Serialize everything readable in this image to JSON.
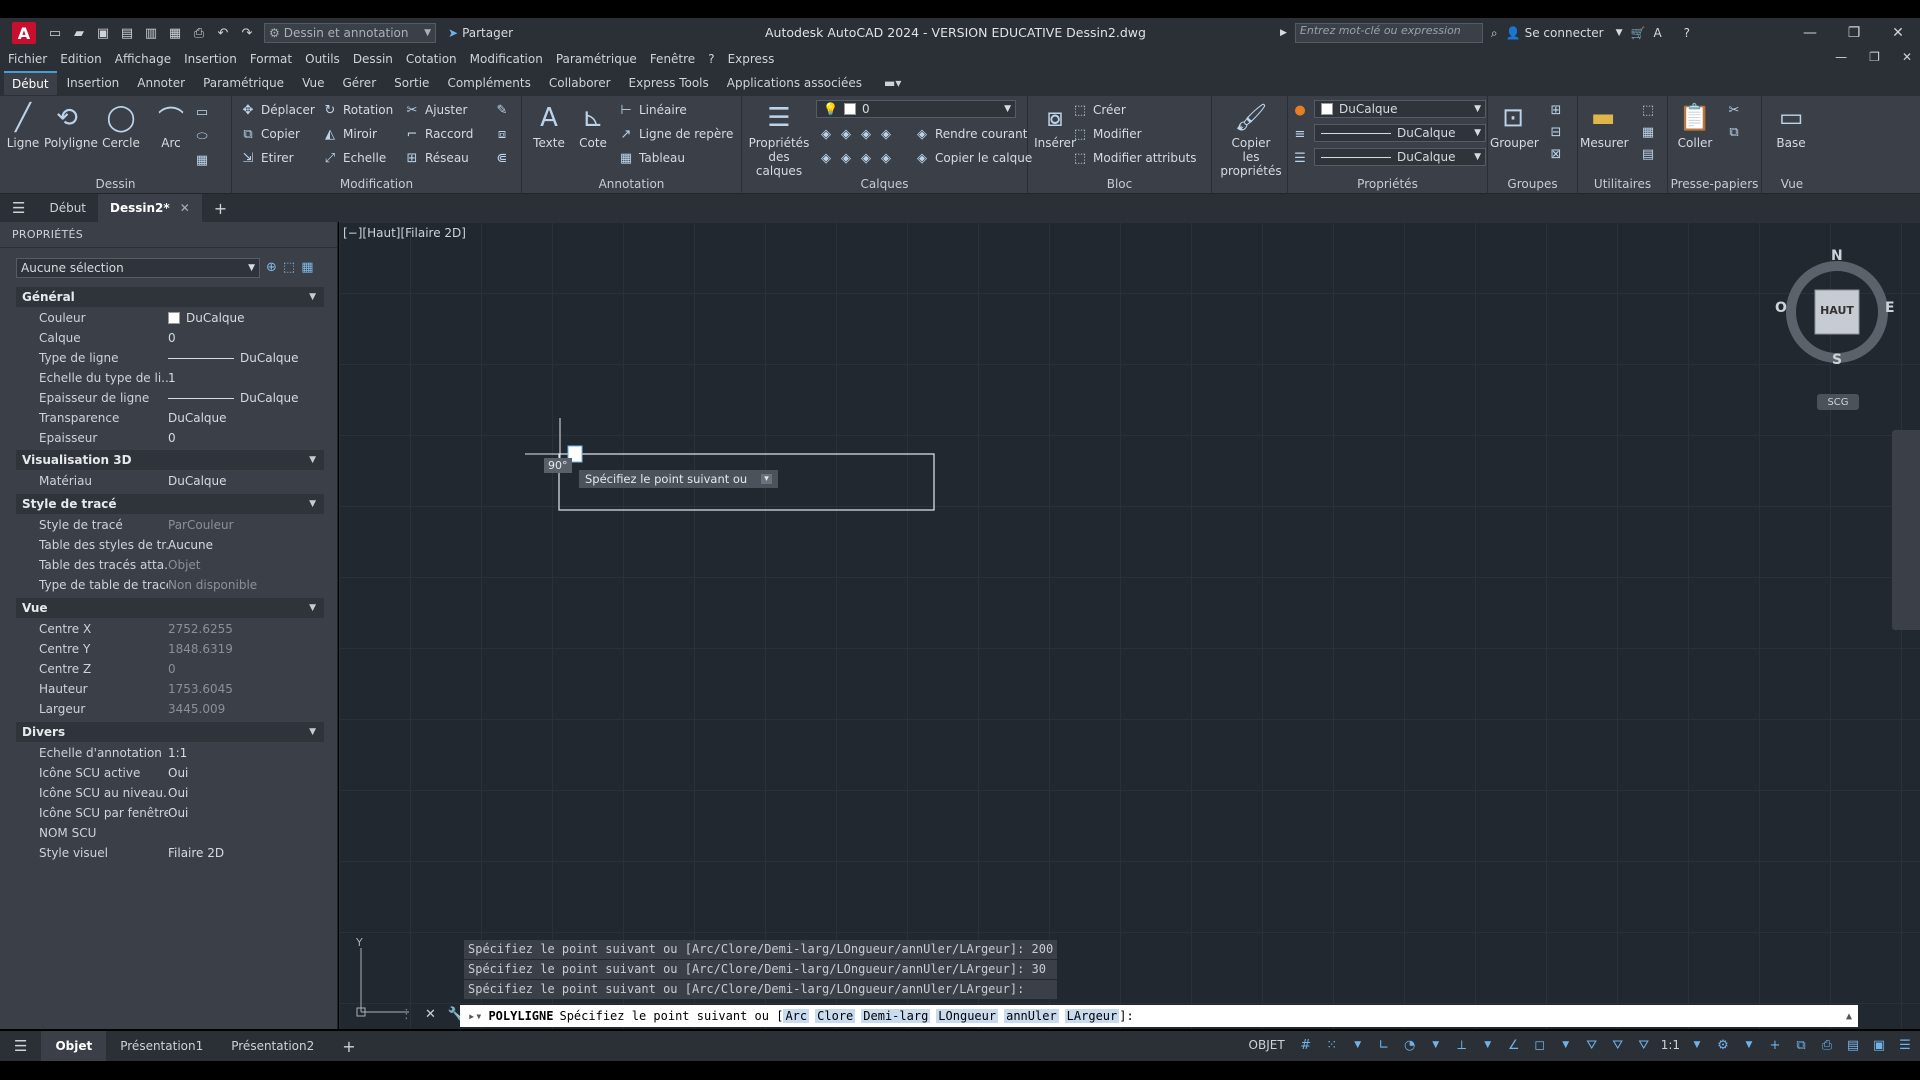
{
  "window": {
    "title": "Autodesk AutoCAD 2024 - VERSION EDUCATIVE    Dessin2.dwg",
    "workspace": "Dessin et annotation",
    "share_label": "Partager",
    "search_placeholder": "Entrez mot-clé ou expression",
    "login_label": "Se connecter"
  },
  "menu": [
    "Fichier",
    "Edition",
    "Affichage",
    "Insertion",
    "Format",
    "Outils",
    "Dessin",
    "Cotation",
    "Modification",
    "Paramétrique",
    "Fenêtre",
    "?",
    "Express"
  ],
  "ribbon_tabs": [
    "Début",
    "Insertion",
    "Annoter",
    "Paramétrique",
    "Vue",
    "Gérer",
    "Sortie",
    "Compléments",
    "Collaborer",
    "Express Tools",
    "Applications associées"
  ],
  "ribbon": {
    "dessin": {
      "title": "Dessin",
      "ligne": "Ligne",
      "polyligne": "Polyligne",
      "cercle": "Cercle",
      "arc": "Arc"
    },
    "modification": {
      "title": "Modification",
      "deplacer": "Déplacer",
      "rotation": "Rotation",
      "ajuster": "Ajuster",
      "copier": "Copier",
      "miroir": "Miroir",
      "raccord": "Raccord",
      "etirer": "Etirer",
      "echelle": "Echelle",
      "reseau": "Réseau"
    },
    "annotation": {
      "title": "Annotation",
      "texte": "Texte",
      "cote": "Cote",
      "lineaire": "Linéaire",
      "ligne_repere": "Ligne de repère",
      "tableau": "Tableau"
    },
    "calques": {
      "title": "Calques",
      "proprietes_1": "Propriétés",
      "proprietes_2": "des calques",
      "current_layer": "0",
      "rendre_courant": "Rendre courant",
      "copier_calque": "Copier le calque"
    },
    "bloc": {
      "title": "Bloc",
      "inserer": "Insérer",
      "creer": "Créer",
      "modifier": "Modifier",
      "modifier_attributs": "Modifier attributs"
    },
    "copier_props": {
      "line1": "Copier",
      "line2": "les propriétés"
    },
    "proprietes": {
      "title": "Propriétés",
      "couleur": "DuCalque",
      "type_ligne": "DuCalque",
      "epaisseur": "DuCalque"
    },
    "groupes": {
      "title": "Groupes",
      "grouper": "Grouper"
    },
    "utilitaires": {
      "title": "Utilitaires",
      "mesurer": "Mesurer"
    },
    "presse_papiers": {
      "title": "Presse-papiers",
      "coller": "Coller"
    },
    "vue": {
      "title": "Vue",
      "base": "Base"
    }
  },
  "doc_tabs": {
    "start": "Début",
    "current": "Dessin2*"
  },
  "properties": {
    "header": "PROPRIÉTÉS",
    "selection": "Aucune sélection",
    "general": {
      "title": "Général",
      "rows": [
        {
          "name": "Couleur",
          "value": "DuCalque"
        },
        {
          "name": "Calque",
          "value": "0"
        },
        {
          "name": "Type de ligne",
          "value": "DuCalque"
        },
        {
          "name": "Echelle du type de li...",
          "value": "1"
        },
        {
          "name": "Epaisseur de ligne",
          "value": "DuCalque"
        },
        {
          "name": "Transparence",
          "value": "DuCalque"
        },
        {
          "name": "Epaisseur",
          "value": "0"
        }
      ]
    },
    "vis3d": {
      "title": "Visualisation 3D",
      "rows": [
        {
          "name": "Matériau",
          "value": "DuCalque"
        }
      ]
    },
    "style_trace": {
      "title": "Style de tracé",
      "rows": [
        {
          "name": "Style de tracé",
          "value": "ParCouleur"
        },
        {
          "name": "Table des styles de tr...",
          "value": "Aucune"
        },
        {
          "name": "Table des tracés atta...",
          "value": "Objet"
        },
        {
          "name": "Type de table de tracé",
          "value": "Non disponible"
        }
      ]
    },
    "vue": {
      "title": "Vue",
      "rows": [
        {
          "name": "Centre X",
          "value": "2752.6255"
        },
        {
          "name": "Centre Y",
          "value": "1848.6319"
        },
        {
          "name": "Centre Z",
          "value": "0"
        },
        {
          "name": "Hauteur",
          "value": "1753.6045"
        },
        {
          "name": "Largeur",
          "value": "3445.009"
        }
      ]
    },
    "divers": {
      "title": "Divers",
      "rows": [
        {
          "name": "Echelle d'annotation",
          "value": "1:1"
        },
        {
          "name": "Icône SCU active",
          "value": "Oui"
        },
        {
          "name": "Icône SCU au niveau...",
          "value": "Oui"
        },
        {
          "name": "Icône SCU par fenêtre",
          "value": "Oui"
        },
        {
          "name": "NOM SCU",
          "value": ""
        },
        {
          "name": "Style visuel",
          "value": "Filaire 2D"
        }
      ]
    }
  },
  "canvas": {
    "view_label": "[−][Haut][Filaire 2D]",
    "angle_tooltip": "90°",
    "prompt_tooltip": "Spécifiez le point suivant ou",
    "compass": {
      "n": "N",
      "s": "S",
      "e": "E",
      "o": "O",
      "center": "HAUT"
    },
    "scg": "SCG",
    "ucs": {
      "y": "Y",
      "x": "X"
    }
  },
  "command": {
    "history": [
      "Spécifiez le point suivant ou [Arc/Clore/Demi-larg/LOngueur/annUler/LArgeur]: 200",
      "Spécifiez le point suivant ou [Arc/Clore/Demi-larg/LOngueur/annUler/LArgeur]: 30",
      "Spécifiez le point suivant ou [Arc/Clore/Demi-larg/LOngueur/annUler/LArgeur]:"
    ],
    "name": "POLYLIGNE",
    "prompt": "Spécifiez le point suivant ou [",
    "options": [
      "Arc",
      "Clore",
      "Demi-larg",
      "LOngueur",
      "annUler",
      "LArgeur"
    ],
    "suffix": "]:"
  },
  "status": {
    "tabs": [
      "Objet",
      "Présentation1",
      "Présentation2"
    ],
    "mode": "OBJET",
    "scale": "1:1"
  }
}
